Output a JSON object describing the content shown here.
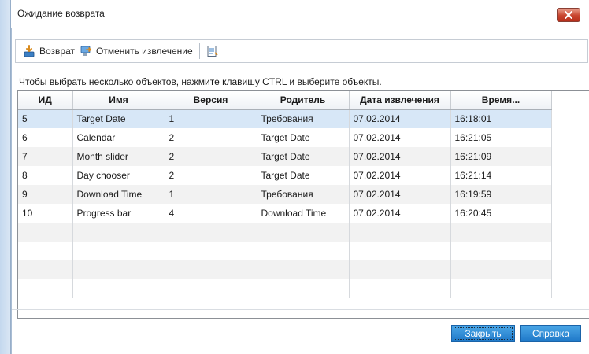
{
  "window": {
    "title": "Ожидание возврата"
  },
  "toolbar": {
    "checkin_label": "Возврат",
    "checkin_icon": "checkin-icon",
    "undo_checkout_label": "Отменить извлечение",
    "undo_checkout_icon": "undo-checkout-icon",
    "details_icon": "details-icon"
  },
  "hint": "Чтобы выбрать несколько объектов, нажмите клавишу CTRL и выберите объекты.",
  "table": {
    "columns": [
      "ИД",
      "Имя",
      "Версия",
      "Родитель",
      "Дата извлечения",
      "Время..."
    ],
    "rows": [
      [
        "5",
        "Target Date",
        "1",
        "Требования",
        "07.02.2014",
        "16:18:01"
      ],
      [
        "6",
        "Calendar",
        "2",
        "Target Date",
        "07.02.2014",
        "16:21:05"
      ],
      [
        "7",
        "Month slider",
        "2",
        "Target Date",
        "07.02.2014",
        "16:21:09"
      ],
      [
        "8",
        "Day chooser",
        "2",
        "Target Date",
        "07.02.2014",
        "16:21:14"
      ],
      [
        "9",
        "Download Time",
        "1",
        "Требования",
        "07.02.2014",
        "16:19:59"
      ],
      [
        "10",
        "Progress bar",
        "4",
        "Download Time",
        "07.02.2014",
        "16:20:45"
      ]
    ],
    "selected_row": 0
  },
  "buttons": {
    "close": "Закрыть",
    "help": "Справка"
  },
  "colors": {
    "selected_row": "#d7e7f7",
    "button": "#2a86d4",
    "close_button": "#c8442e"
  }
}
